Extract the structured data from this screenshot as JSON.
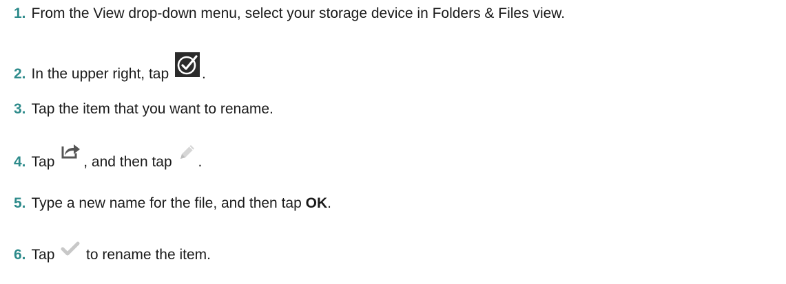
{
  "steps": [
    {
      "num": "1.",
      "text": "From the View drop-down menu, select your storage device in Folders & Files view."
    },
    {
      "num": "2.",
      "text_before": "In the upper right, tap ",
      "icon": "check-circle-icon",
      "text_after": "."
    },
    {
      "num": "3.",
      "text": "Tap the item that you want to rename."
    },
    {
      "num": "4.",
      "text_before": "Tap ",
      "icon": "share-icon",
      "text_mid": ", and then tap ",
      "icon2": "pencil-icon",
      "text_after": "."
    },
    {
      "num": "5.",
      "text_before": "Type a new name for the file, and then tap ",
      "bold": "OK",
      "text_after": "."
    },
    {
      "num": "6.",
      "text_before": "Tap ",
      "icon": "checkmark-icon",
      "text_after": " to rename the item."
    }
  ],
  "colors": {
    "step_number": "#2e8b8b",
    "icon_dark": "#2b2b2b",
    "icon_light": "#c8c8c8",
    "share_icon": "#555555"
  }
}
